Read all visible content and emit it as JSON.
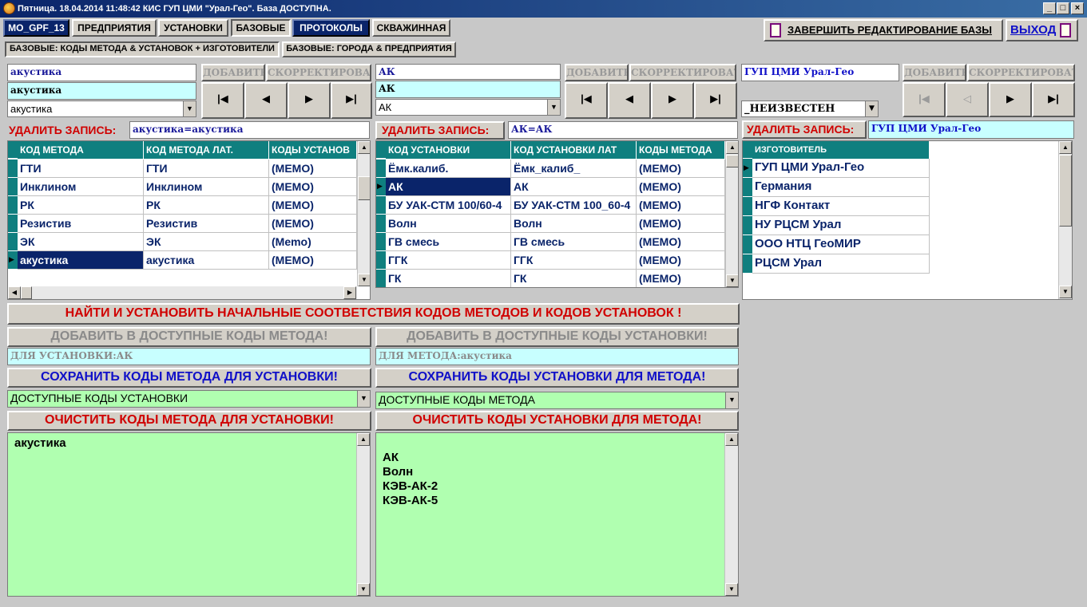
{
  "window": {
    "title": "Пятница. 18.04.2014 11:48:42  КИС ГУП ЦМИ \"Урал-Гео\". База ДОСТУПНА."
  },
  "toolbar": {
    "buttons": [
      "MO_GPF_13",
      "ПРЕДПРИЯТИЯ",
      "УСТАНОВКИ",
      "БАЗОВЫЕ",
      "ПРОТОКОЛЫ",
      "СКВАЖИННАЯ"
    ],
    "finish_edit": "ЗАВЕРШИТЬ РЕДАКТИРОВАНИЕ БАЗЫ",
    "exit": "ВЫХОД"
  },
  "tabs": [
    "БАЗОВЫЕ: КОДЫ МЕТОДА & УСТАНОВОК + ИЗГОТОВИТЕЛИ",
    "БАЗОВЫЕ: ГОРОДА & ПРЕДПРИЯТИЯ"
  ],
  "common": {
    "add": "ДОБАВИТЬ",
    "correct": "СКОРРЕКТИРОВАТЬ",
    "delete_record": "УДАЛИТЬ ЗАПИСЬ:"
  },
  "methods": {
    "field1": "акустика",
    "field2": "акустика",
    "combo": "акустика",
    "delete_value": "акустика=акустика",
    "headers": [
      "КОД МЕТОДА",
      "КОД МЕТОДА ЛАТ.",
      "КОДЫ УСТАНОВ"
    ],
    "rows": [
      [
        "ГТИ",
        "ГТИ",
        "(MEMO)"
      ],
      [
        "Инклином",
        "Инклином",
        "(MEMO)"
      ],
      [
        "РК",
        "РК",
        "(MEMO)"
      ],
      [
        "Резистив",
        "Резистив",
        "(MEMO)"
      ],
      [
        "ЭК",
        "ЭК",
        "(Memo)"
      ],
      [
        "акустика",
        "акустика",
        "(MEMO)"
      ]
    ]
  },
  "installations": {
    "field1": "АК",
    "field2": "АК",
    "combo": "АК",
    "delete_value": "АК=АК",
    "headers": [
      "КОД УСТАНОВКИ",
      "КОД УСТАНОВКИ ЛАТ",
      "КОДЫ МЕТОДА"
    ],
    "rows": [
      [
        "Ёмк.калиб.",
        "Ёмк_калиб_",
        "(MEMO)"
      ],
      [
        "АК",
        "АК",
        "(MEMO)"
      ],
      [
        "БУ УАК-СТМ 100/60-4",
        "БУ УАК-СТМ 100_60-4",
        "(MEMO)"
      ],
      [
        "Волн",
        "Волн",
        "(MEMO)"
      ],
      [
        "ГВ смесь",
        "ГВ смесь",
        "(MEMO)"
      ],
      [
        "ГГК",
        "ГГК",
        "(MEMO)"
      ],
      [
        "ГК",
        "ГК",
        "(MEMO)"
      ]
    ]
  },
  "makers": {
    "field1": "ГУП ЦМИ Урал-Гео",
    "combo": "_НЕИЗВЕСТЕН",
    "delete_value": "ГУП ЦМИ Урал-Гео",
    "header": "ИЗГОТОВИТЕЛЬ",
    "rows": [
      "ГУП ЦМИ Урал-Гео",
      "Германия",
      "НГФ Контакт",
      "НУ РЦСМ Урал",
      "ООО НТЦ ГеоМИР",
      "РЦСМ Урал"
    ]
  },
  "actions": {
    "find_match": "НАЙТИ И УСТАНОВИТЬ НАЧАЛЬНЫЕ СООТВЕТСТВИЯ КОДОВ МЕТОДОВ И КОДОВ УСТАНОВОК !",
    "add_method_codes": "ДОБАВИТЬ В ДОСТУПНЫЕ КОДЫ МЕТОДА!",
    "add_inst_codes": "ДОБАВИТЬ В ДОСТУПНЫЕ КОДЫ УСТАНОВКИ!",
    "for_inst": "ДЛЯ УСТАНОВКИ:АК",
    "for_method": "ДЛЯ МЕТОДА:акустика",
    "save_method_codes": "СОХРАНИТЬ КОДЫ МЕТОДА ДЛЯ УСТАНОВКИ!",
    "save_inst_codes": "СОХРАНИТЬ КОДЫ УСТАНОВКИ ДЛЯ МЕТОДА!",
    "avail_inst_codes": "ДОСТУПНЫЕ КОДЫ УСТАНОВКИ",
    "avail_method_codes": "ДОСТУПНЫЕ КОДЫ МЕТОДА",
    "clear_method_codes": "ОЧИСТИТЬ КОДЫ МЕТОДА ДЛЯ УСТАНОВКИ!",
    "clear_inst_codes": "ОЧИСТИТЬ КОДЫ УСТАНОВКИ ДЛЯ МЕТОДА!"
  },
  "memo_left": [
    "акустика"
  ],
  "memo_right": [
    "",
    "АК",
    "Волн",
    "КЭВ-АК-2",
    "КЭВ-АК-5"
  ]
}
